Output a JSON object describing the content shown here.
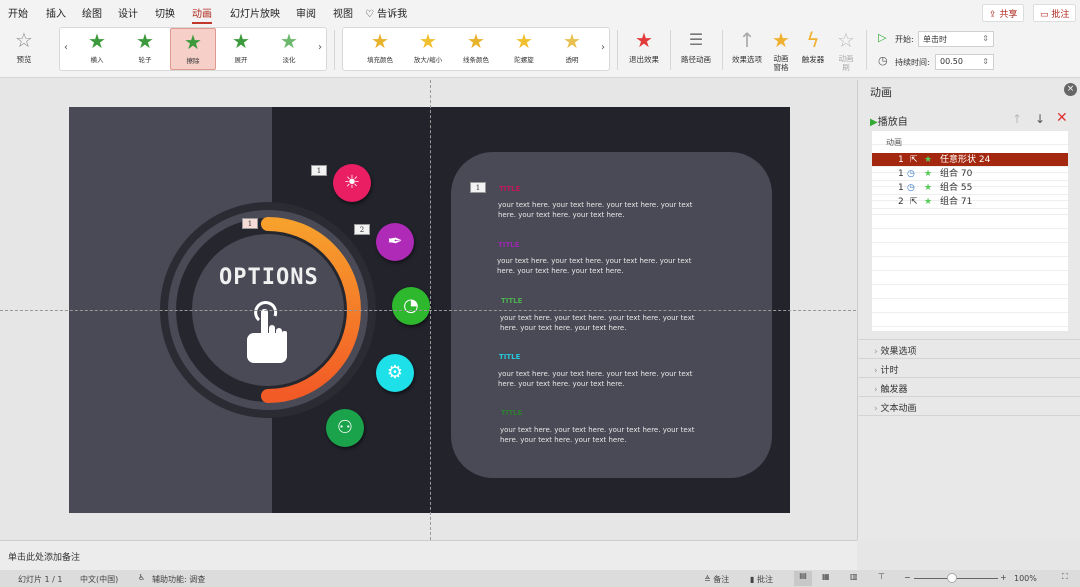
{
  "tabs": [
    "开始",
    "插入",
    "绘图",
    "设计",
    "切换",
    "动画",
    "幻灯片放映",
    "审阅",
    "视图",
    "告诉我"
  ],
  "share": "共享",
  "comments": "批注",
  "ribbon": {
    "preview": "预览",
    "entrance": [
      "横入",
      "轮子",
      "擦除",
      "展开",
      "淡化"
    ],
    "emphasis": [
      "填充颜色",
      "放大/缩小",
      "线条颜色",
      "陀螺旋",
      "透明"
    ],
    "exit": "退出效果",
    "path": "路径动画",
    "effect_options": "效果选项",
    "anim_pane": "动画\n窗格",
    "trigger": "触发器",
    "anim_painter": "动画\n刷",
    "start_label": "开始:",
    "start_value": "单击时",
    "duration_label": "持续时间:",
    "duration_value": "00.50"
  },
  "slide": {
    "options": "OPTIONS",
    "badges": [
      "1",
      "1",
      "2",
      "1"
    ],
    "items": [
      {
        "title": "TITLE",
        "color": "#c2185b",
        "text": "your text here. your text here. your text here. your text here. your text here. your text here."
      },
      {
        "title": "TITLE",
        "color": "#9c27b0",
        "text": "your text here. your text here. your text here. your text here. your text here. your text here."
      },
      {
        "title": "TITLE",
        "color": "#4caf50",
        "text": "your text here. your text here. your text here. your text here. your text here. your text here."
      },
      {
        "title": "TITLE",
        "color": "#26c6da",
        "text": "your text here. your text here. your text here. your text here. your text here. your text here."
      },
      {
        "title": "TITLE",
        "color": "#2e7d32",
        "text": "your text here. your text here. your text here. your text here. your text here. your text here."
      }
    ]
  },
  "pane": {
    "title": "动画",
    "play_from": "播放自",
    "list_header": "动画",
    "rows": [
      {
        "num": "1",
        "name": "任意形状 24"
      },
      {
        "num": "1",
        "name": "组合 70"
      },
      {
        "num": "1",
        "name": "组合 55"
      },
      {
        "num": "2",
        "name": "组合 71"
      }
    ],
    "sections": [
      "效果选项",
      "计时",
      "触发器",
      "文本动画"
    ]
  },
  "notes_placeholder": "单击此处添加备注",
  "status": {
    "slide": "幻灯片 1 / 1",
    "lang": "中文(中国)",
    "accessibility": "辅助功能: 调查",
    "notes": "备注",
    "comments": "批注",
    "zoom": "100%"
  }
}
